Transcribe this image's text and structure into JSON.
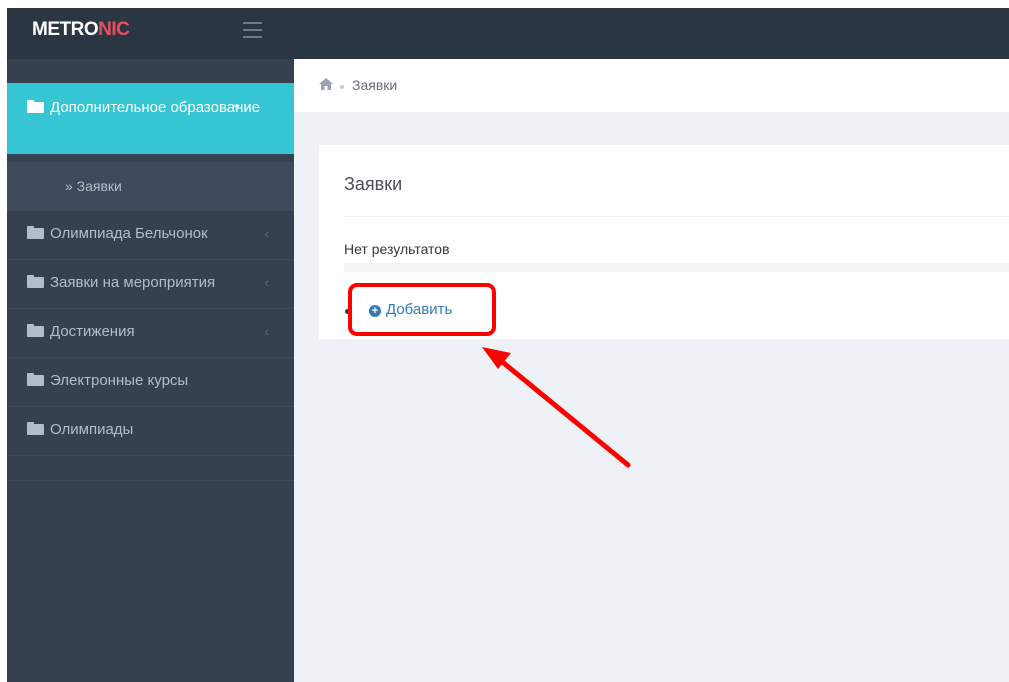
{
  "app": {
    "logo_part1": "METRO",
    "logo_part2": "NIC"
  },
  "sidebar": {
    "open_item": {
      "label": "Дополнительное образование"
    },
    "sub_item": {
      "label": "» Заявки"
    },
    "items": [
      {
        "label": "Олимпиада Бельчонок",
        "has_chevron": true
      },
      {
        "label": "Заявки на мероприятия",
        "has_chevron": true
      },
      {
        "label": "Достижения",
        "has_chevron": true
      },
      {
        "label": "Электронные курсы",
        "has_chevron": false
      },
      {
        "label": "Олимпиады",
        "has_chevron": false
      }
    ]
  },
  "breadcrumb": {
    "home_icon": "home-icon",
    "current": "Заявки"
  },
  "portlet": {
    "title": "Заявки",
    "empty_text": "Нет результатов",
    "add_button": {
      "label": "Добавить",
      "icon": "plus-circle-icon"
    }
  },
  "annotation": {
    "highlight_color": "#ff0000"
  },
  "colors": {
    "sidebar_bg": "#364150",
    "active_bg": "#36c6d3",
    "topbar_bg": "#2b3643",
    "logo_accent": "#e7505a",
    "link": "#337ab7"
  }
}
